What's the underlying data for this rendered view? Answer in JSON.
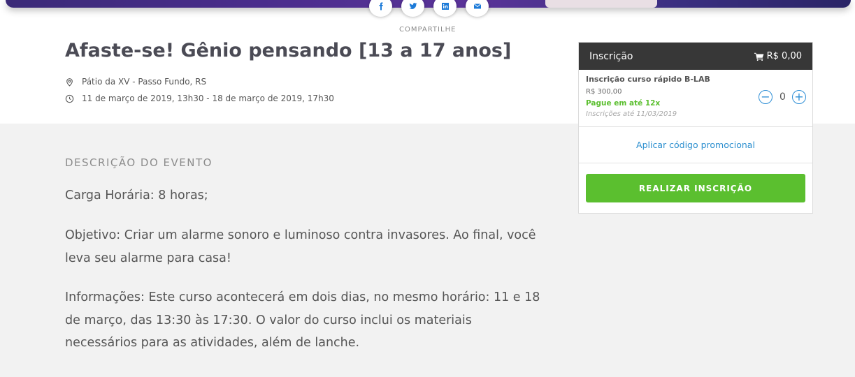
{
  "share": {
    "label": "COMPARTILHE",
    "buttons": [
      "facebook-icon",
      "twitter-icon",
      "linkedin-icon",
      "email-icon"
    ]
  },
  "event": {
    "title": "Afaste-se! Gênio pensando [13 a 17 anos]",
    "location": "Pátio da XV - Passo Fundo, RS",
    "datetime": "11 de março de 2019, 13h30 - 18 de março de 2019, 17h30"
  },
  "description": {
    "heading": "DESCRIÇÃO DO EVENTO",
    "paragraphs": [
      "Carga Horária: 8 horas;",
      "Objetivo: Criar um alarme sonoro e luminoso contra invasores. Ao final, você leva seu alarme para casa!",
      "Informações: Este curso acontecerá em dois dias, no mesmo horário: 11 e 18 de março, das 13:30 às 17:30. O valor do curso inclui os materiais necessários para as atividades, além de lanche."
    ]
  },
  "registration": {
    "header_label": "Inscrição",
    "total": "R$ 0,00",
    "ticket": {
      "name": "Inscrição curso rápido B-LAB",
      "price": "R$ 300,00",
      "installments": "Pague em até 12x",
      "deadline": "Inscrições até 11/03/2019",
      "quantity": "0"
    },
    "promo_label": "Aplicar código promocional",
    "submit_label": "REALIZAR INSCRIÇÃO"
  },
  "colors": {
    "accent_green": "#5bbf2f",
    "link_blue": "#2c8fcf",
    "header_dark": "#373737"
  }
}
